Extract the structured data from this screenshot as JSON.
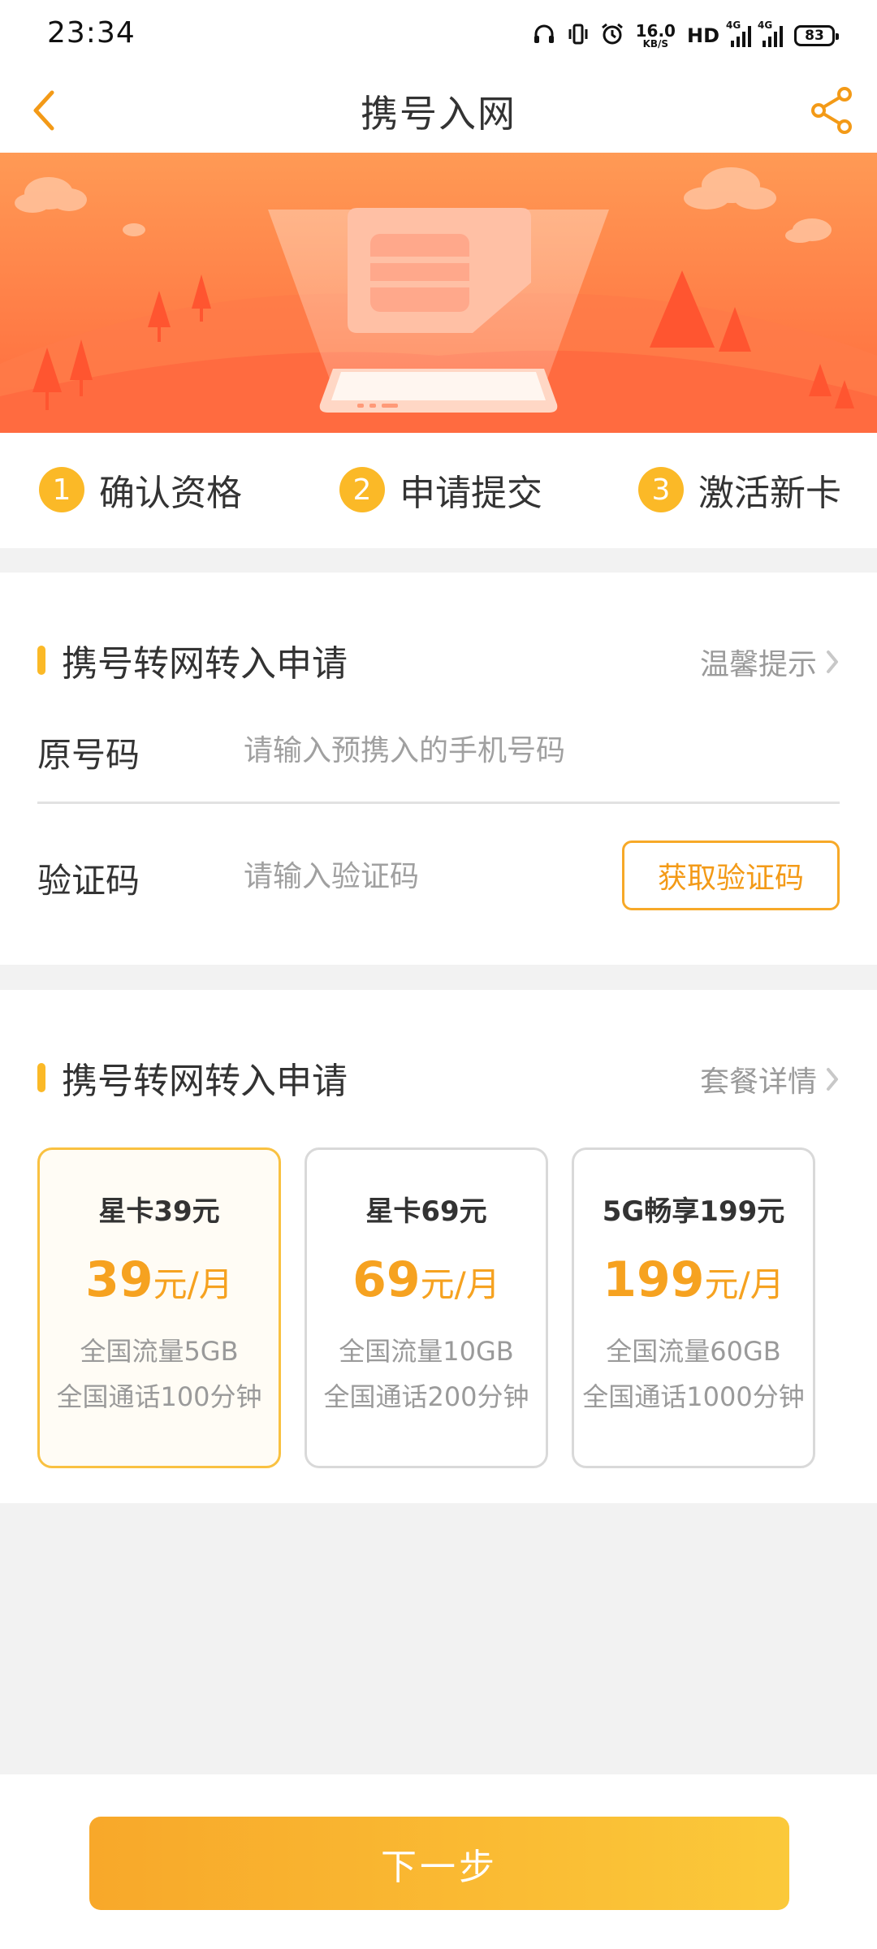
{
  "status_bar": {
    "time": "23:34",
    "net_speed_value": "16.0",
    "net_speed_unit": "KB/S",
    "hd_label": "HD",
    "network_1": "4G",
    "network_2": "4G",
    "battery": "83",
    "icons": [
      "headphone-icon",
      "vibrate-icon",
      "alarm-icon",
      "signal-icon",
      "signal-icon",
      "battery-icon"
    ]
  },
  "nav": {
    "title": "携号入网",
    "back_icon": "chevron-left-icon",
    "share_icon": "share-icon"
  },
  "colors": {
    "accent": "#fbb927",
    "accent_text": "#f6a220",
    "banner_top": "#ff9a55",
    "banner_bottom": "#ff6a3d"
  },
  "steps": [
    {
      "number": "1",
      "label": "确认资格"
    },
    {
      "number": "2",
      "label": "申请提交"
    },
    {
      "number": "3",
      "label": "激活新卡"
    }
  ],
  "transfer_form": {
    "title": "携号转网转入申请",
    "link": "温馨提示",
    "phone_label": "原号码",
    "phone_placeholder": "请输入预携入的手机号码",
    "code_label": "验证码",
    "code_placeholder": "请输入验证码",
    "get_code_button": "获取验证码"
  },
  "plans_section": {
    "title": "携号转网转入申请",
    "link": "套餐详情",
    "selected_index": 0,
    "items": [
      {
        "name": "星卡39元",
        "price": "39",
        "unit": "元/月",
        "data": "全国流量5GB",
        "calls": "全国通话100分钟"
      },
      {
        "name": "星卡69元",
        "price": "69",
        "unit": "元/月",
        "data": "全国流量10GB",
        "calls": "全国通话200分钟"
      },
      {
        "name": "5G畅享199元",
        "price": "199",
        "unit": "元/月",
        "data": "全国流量60GB",
        "calls": "全国通话1000分钟"
      }
    ]
  },
  "footer": {
    "next_button": "下一步"
  }
}
